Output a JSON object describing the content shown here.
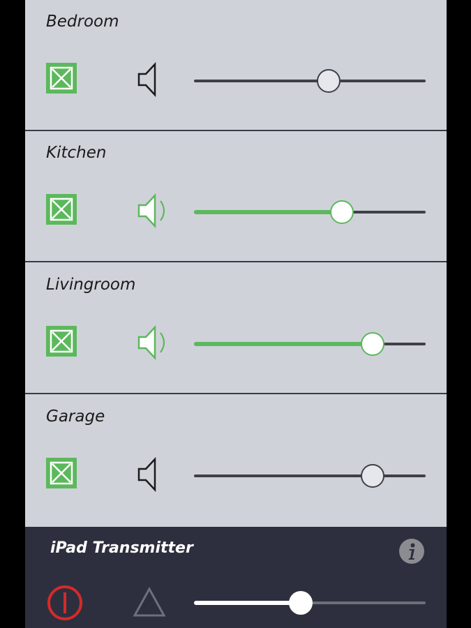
{
  "colors": {
    "panel_bg": "#d0d2da",
    "active_green": "#5cb85c",
    "inactive_dark": "#1a1a1a",
    "transmitter_bg": "#2d2f3e",
    "power_red": "#d42a2a"
  },
  "rooms": [
    {
      "name": "Bedroom",
      "enabled": true,
      "speaker_active": false,
      "volume": 0.58,
      "icon_toggle": "enabled-toggle-icon",
      "icon_speaker": "speaker-icon"
    },
    {
      "name": "Kitchen",
      "enabled": true,
      "speaker_active": true,
      "volume": 0.64,
      "icon_toggle": "enabled-toggle-icon",
      "icon_speaker": "speaker-sound-icon"
    },
    {
      "name": "Livingroom",
      "enabled": true,
      "speaker_active": true,
      "volume": 0.77,
      "icon_toggle": "enabled-toggle-icon",
      "icon_speaker": "speaker-sound-icon"
    },
    {
      "name": "Garage",
      "enabled": true,
      "speaker_active": false,
      "volume": 0.77,
      "icon_toggle": "enabled-toggle-icon",
      "icon_speaker": "speaker-icon"
    }
  ],
  "transmitter": {
    "title": "iPad Transmitter",
    "volume": 0.46,
    "icons": [
      "power-icon",
      "warning-triangle-icon",
      "info-icon"
    ]
  }
}
